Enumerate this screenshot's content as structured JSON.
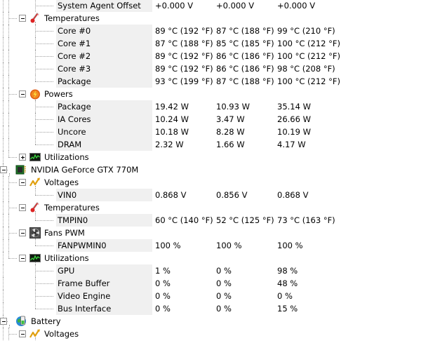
{
  "rows": [
    {
      "type": "sensor",
      "label": "System Agent Offset",
      "v": [
        "+0.000 V",
        "+0.000 V",
        "+0.000 V"
      ]
    },
    {
      "type": "group",
      "level": 1,
      "label": "Temperatures",
      "icon": "thermometer-icon",
      "exp": "minus"
    },
    {
      "type": "sensor",
      "label": "Core #0",
      "v": [
        "89 °C  (192 °F)",
        "87 °C  (188 °F)",
        "99 °C  (210 °F)"
      ]
    },
    {
      "type": "sensor",
      "label": "Core #1",
      "v": [
        "87 °C  (188 °F)",
        "85 °C  (185 °F)",
        "100 °C  (212 °F)"
      ]
    },
    {
      "type": "sensor",
      "label": "Core #2",
      "v": [
        "89 °C  (192 °F)",
        "86 °C  (186 °F)",
        "100 °C  (212 °F)"
      ]
    },
    {
      "type": "sensor",
      "label": "Core #3",
      "v": [
        "89 °C  (192 °F)",
        "86 °C  (186 °F)",
        "98 °C  (208 °F)"
      ]
    },
    {
      "type": "sensor",
      "label": "Package",
      "v": [
        "93 °C  (199 °F)",
        "87 °C  (188 °F)",
        "100 °C  (212 °F)"
      ],
      "last": true
    },
    {
      "type": "group",
      "level": 1,
      "label": "Powers",
      "icon": "power-icon",
      "exp": "minus"
    },
    {
      "type": "sensor",
      "label": "Package",
      "v": [
        "19.42 W",
        "10.93 W",
        "35.14 W"
      ]
    },
    {
      "type": "sensor",
      "label": "IA Cores",
      "v": [
        "10.24 W",
        "3.47 W",
        "26.66 W"
      ]
    },
    {
      "type": "sensor",
      "label": "Uncore",
      "v": [
        "10.18 W",
        "8.28 W",
        "10.19 W"
      ]
    },
    {
      "type": "sensor",
      "label": "DRAM",
      "v": [
        "2.32 W",
        "1.66 W",
        "4.17 W"
      ],
      "last": true
    },
    {
      "type": "group",
      "level": 1,
      "label": "Utilizations",
      "icon": "utilization-icon",
      "exp": "plus",
      "last": true
    },
    {
      "type": "device",
      "label": "NVIDIA GeForce GTX 770M",
      "icon": "gpu-icon",
      "exp": "minus"
    },
    {
      "type": "group",
      "level": 1,
      "label": "Voltages",
      "icon": "voltage-icon",
      "exp": "minus"
    },
    {
      "type": "sensor",
      "label": "VIN0",
      "v": [
        "0.868 V",
        "0.856 V",
        "0.868 V"
      ],
      "last": true
    },
    {
      "type": "group",
      "level": 1,
      "label": "Temperatures",
      "icon": "thermometer-icon",
      "exp": "minus"
    },
    {
      "type": "sensor",
      "label": "TMPIN0",
      "v": [
        "60 °C  (140 °F)",
        "52 °C  (125 °F)",
        "73 °C  (163 °F)"
      ],
      "last": true
    },
    {
      "type": "group",
      "level": 1,
      "label": "Fans PWM",
      "icon": "fan-icon",
      "exp": "minus"
    },
    {
      "type": "sensor",
      "label": "FANPWMIN0",
      "v": [
        "100 %",
        "100 %",
        "100 %"
      ],
      "last": true
    },
    {
      "type": "group",
      "level": 1,
      "label": "Utilizations",
      "icon": "utilization-icon",
      "exp": "minus",
      "last": true
    },
    {
      "type": "sensor",
      "label": "GPU",
      "v": [
        "1 %",
        "0 %",
        "98 %"
      ],
      "plast": true
    },
    {
      "type": "sensor",
      "label": "Frame Buffer",
      "v": [
        "0 %",
        "0 %",
        "48 %"
      ],
      "plast": true
    },
    {
      "type": "sensor",
      "label": "Video Engine",
      "v": [
        "0 %",
        "0 %",
        "0 %"
      ],
      "plast": true
    },
    {
      "type": "sensor",
      "label": "Bus Interface",
      "v": [
        "0 %",
        "0 %",
        "15 %"
      ],
      "plast": true,
      "last": true
    },
    {
      "type": "device",
      "label": "Battery",
      "icon": "battery-icon",
      "exp": "minus"
    },
    {
      "type": "group",
      "level": 1,
      "label": "Voltages",
      "icon": "voltage-icon",
      "exp": "minus"
    }
  ]
}
